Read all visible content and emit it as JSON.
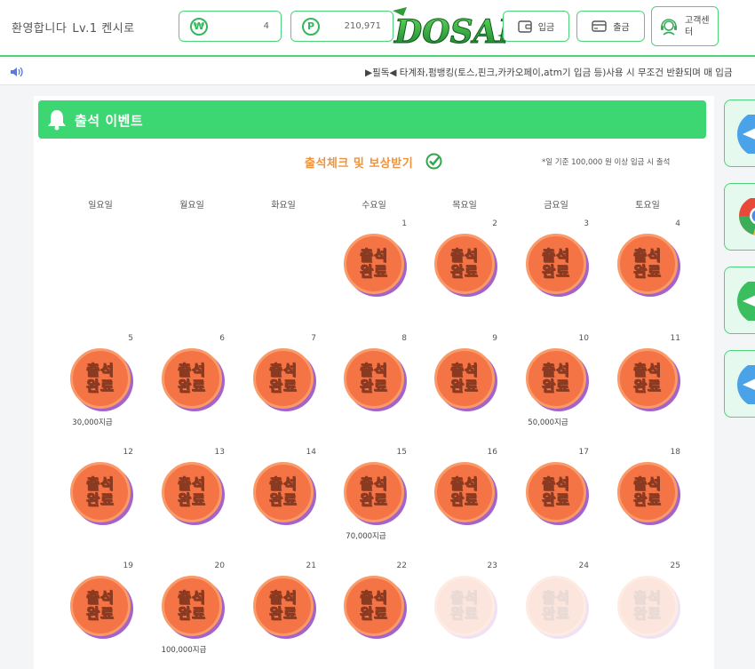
{
  "header": {
    "welcome": "환영합니다",
    "level": "Lv.1 켄시로",
    "money_symbol": "₩",
    "money_value": "4",
    "point_symbol": "P",
    "point_value": "210,971",
    "logo_text": "DOSAN",
    "deposit_label": "입금",
    "withdraw_label": "출금",
    "support_label": "고객센터"
  },
  "ticker": {
    "text": "▶필독◀ 타계좌,펌뱅킹(토스,핀크,카카오페이,atm기 입금 등)사용 시 무조건 반환되며 매 입금"
  },
  "event": {
    "title": "출석 이벤트",
    "subtitle": "출석체크 및 보상받기",
    "note": "*일 기준 100,000 원 이상 입금 시 출석",
    "stamp_line1": "출석",
    "stamp_line2": "완료",
    "weekdays": [
      "일요일",
      "월요일",
      "화요일",
      "수요일",
      "목요일",
      "금요일",
      "토요일"
    ],
    "days": [
      {
        "day": "1",
        "done": true,
        "reward": ""
      },
      {
        "day": "2",
        "done": true,
        "reward": ""
      },
      {
        "day": "3",
        "done": true,
        "reward": ""
      },
      {
        "day": "4",
        "done": true,
        "reward": ""
      },
      {
        "day": "5",
        "done": true,
        "reward": "30,000지급"
      },
      {
        "day": "6",
        "done": true,
        "reward": ""
      },
      {
        "day": "7",
        "done": true,
        "reward": ""
      },
      {
        "day": "8",
        "done": true,
        "reward": ""
      },
      {
        "day": "9",
        "done": true,
        "reward": ""
      },
      {
        "day": "10",
        "done": true,
        "reward": "50,000지급"
      },
      {
        "day": "11",
        "done": true,
        "reward": ""
      },
      {
        "day": "12",
        "done": true,
        "reward": ""
      },
      {
        "day": "13",
        "done": true,
        "reward": ""
      },
      {
        "day": "14",
        "done": true,
        "reward": ""
      },
      {
        "day": "15",
        "done": true,
        "reward": "70,000지급"
      },
      {
        "day": "16",
        "done": true,
        "reward": ""
      },
      {
        "day": "17",
        "done": true,
        "reward": ""
      },
      {
        "day": "18",
        "done": true,
        "reward": ""
      },
      {
        "day": "19",
        "done": true,
        "reward": ""
      },
      {
        "day": "20",
        "done": true,
        "reward": "100,000지급"
      },
      {
        "day": "21",
        "done": true,
        "reward": ""
      },
      {
        "day": "22",
        "done": true,
        "reward": ""
      },
      {
        "day": "23",
        "done": false,
        "reward": ""
      },
      {
        "day": "24",
        "done": false,
        "reward": ""
      },
      {
        "day": "25",
        "done": false,
        "reward": ""
      }
    ]
  },
  "colors": {
    "accent": "#3cd672",
    "stamp": "#f47446",
    "stamp_shadow": "#a363c8",
    "subtitle": "#f0923a"
  },
  "side_icons": [
    "telegram-icon",
    "chrome-icon",
    "telegram-green-icon",
    "telegram-icon"
  ]
}
